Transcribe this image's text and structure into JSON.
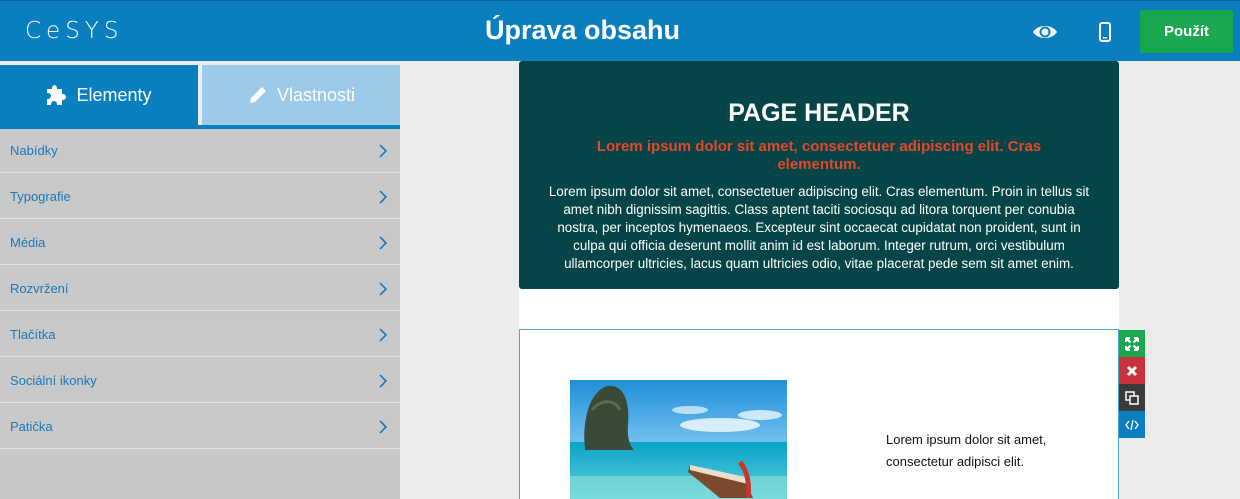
{
  "topbar": {
    "logo": "CeSYS",
    "title": "Úprava obsahu",
    "preview_icon": "eye-icon",
    "mobile_icon": "mobile-phone-icon",
    "apply_label": "Použít",
    "colors": {
      "bar": "#0a7fc0",
      "apply": "#1ba74f"
    }
  },
  "sidebar": {
    "tabs": [
      {
        "label": "Elementy",
        "icon": "puzzle-icon",
        "active": true
      },
      {
        "label": "Vlastnosti",
        "icon": "pencil-icon",
        "active": false
      }
    ],
    "items": [
      {
        "label": "Nabídky"
      },
      {
        "label": "Typografie"
      },
      {
        "label": "Média"
      },
      {
        "label": "Rozvržení"
      },
      {
        "label": "Tlačítka"
      },
      {
        "label": "Sociální ikonky"
      },
      {
        "label": "Patička"
      }
    ]
  },
  "content": {
    "header": {
      "title": "PAGE HEADER",
      "subtitle": "Lorem ipsum dolor sit amet, consectetuer adipiscing elit. Cras elementum.",
      "body": "Lorem ipsum dolor sit amet, consectetuer adipiscing elit. Cras elementum. Proin in tellus sit amet nibh dignissim sagittis. Class aptent taciti sociosqu ad litora torquent per conubia nostra, per inceptos hymenaeos. Excepteur sint occaecat cupidatat non proident, sunt in culpa qui officia deserunt mollit anim id est laborum. Integer rutrum, orci vestibulum ullamcorper ultricies, lacus quam ultricies odio, vitae placerat pede sem sit amet enim.",
      "colors": {
        "background": "#064547",
        "subtitle": "#e4472a"
      }
    },
    "image_block": {
      "text": "Lorem ipsum dolor sit amet, consectetur adipisci elit."
    },
    "block_tools": [
      {
        "icon": "move-arrows-icon",
        "color": "#1ba74f"
      },
      {
        "icon": "delete-x-icon",
        "color": "#c8323a"
      },
      {
        "icon": "copy-icon",
        "color": "#3a3a3a"
      },
      {
        "icon": "code-icon",
        "color": "#0a7fc0"
      }
    ]
  }
}
